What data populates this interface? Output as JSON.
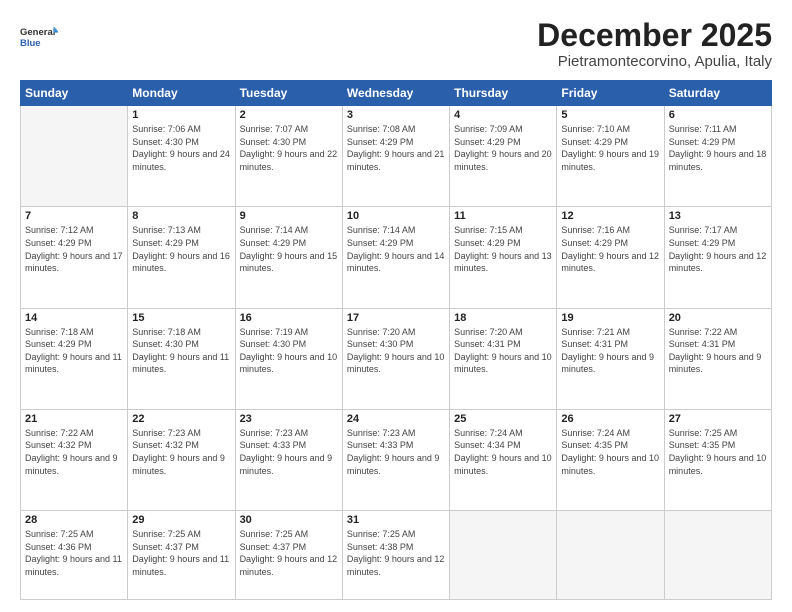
{
  "header": {
    "logo_general": "General",
    "logo_blue": "Blue",
    "month_title": "December 2025",
    "location": "Pietramontecorvino, Apulia, Italy"
  },
  "days_of_week": [
    "Sunday",
    "Monday",
    "Tuesday",
    "Wednesday",
    "Thursday",
    "Friday",
    "Saturday"
  ],
  "weeks": [
    [
      {
        "num": "",
        "empty": true
      },
      {
        "num": "1",
        "sunrise": "7:06 AM",
        "sunset": "4:30 PM",
        "daylight": "9 hours and 24 minutes."
      },
      {
        "num": "2",
        "sunrise": "7:07 AM",
        "sunset": "4:30 PM",
        "daylight": "9 hours and 22 minutes."
      },
      {
        "num": "3",
        "sunrise": "7:08 AM",
        "sunset": "4:29 PM",
        "daylight": "9 hours and 21 minutes."
      },
      {
        "num": "4",
        "sunrise": "7:09 AM",
        "sunset": "4:29 PM",
        "daylight": "9 hours and 20 minutes."
      },
      {
        "num": "5",
        "sunrise": "7:10 AM",
        "sunset": "4:29 PM",
        "daylight": "9 hours and 19 minutes."
      },
      {
        "num": "6",
        "sunrise": "7:11 AM",
        "sunset": "4:29 PM",
        "daylight": "9 hours and 18 minutes."
      }
    ],
    [
      {
        "num": "7",
        "sunrise": "7:12 AM",
        "sunset": "4:29 PM",
        "daylight": "9 hours and 17 minutes."
      },
      {
        "num": "8",
        "sunrise": "7:13 AM",
        "sunset": "4:29 PM",
        "daylight": "9 hours and 16 minutes."
      },
      {
        "num": "9",
        "sunrise": "7:14 AM",
        "sunset": "4:29 PM",
        "daylight": "9 hours and 15 minutes."
      },
      {
        "num": "10",
        "sunrise": "7:14 AM",
        "sunset": "4:29 PM",
        "daylight": "9 hours and 14 minutes."
      },
      {
        "num": "11",
        "sunrise": "7:15 AM",
        "sunset": "4:29 PM",
        "daylight": "9 hours and 13 minutes."
      },
      {
        "num": "12",
        "sunrise": "7:16 AM",
        "sunset": "4:29 PM",
        "daylight": "9 hours and 12 minutes."
      },
      {
        "num": "13",
        "sunrise": "7:17 AM",
        "sunset": "4:29 PM",
        "daylight": "9 hours and 12 minutes."
      }
    ],
    [
      {
        "num": "14",
        "sunrise": "7:18 AM",
        "sunset": "4:29 PM",
        "daylight": "9 hours and 11 minutes."
      },
      {
        "num": "15",
        "sunrise": "7:18 AM",
        "sunset": "4:30 PM",
        "daylight": "9 hours and 11 minutes."
      },
      {
        "num": "16",
        "sunrise": "7:19 AM",
        "sunset": "4:30 PM",
        "daylight": "9 hours and 10 minutes."
      },
      {
        "num": "17",
        "sunrise": "7:20 AM",
        "sunset": "4:30 PM",
        "daylight": "9 hours and 10 minutes."
      },
      {
        "num": "18",
        "sunrise": "7:20 AM",
        "sunset": "4:31 PM",
        "daylight": "9 hours and 10 minutes."
      },
      {
        "num": "19",
        "sunrise": "7:21 AM",
        "sunset": "4:31 PM",
        "daylight": "9 hours and 9 minutes."
      },
      {
        "num": "20",
        "sunrise": "7:22 AM",
        "sunset": "4:31 PM",
        "daylight": "9 hours and 9 minutes."
      }
    ],
    [
      {
        "num": "21",
        "sunrise": "7:22 AM",
        "sunset": "4:32 PM",
        "daylight": "9 hours and 9 minutes."
      },
      {
        "num": "22",
        "sunrise": "7:23 AM",
        "sunset": "4:32 PM",
        "daylight": "9 hours and 9 minutes."
      },
      {
        "num": "23",
        "sunrise": "7:23 AM",
        "sunset": "4:33 PM",
        "daylight": "9 hours and 9 minutes."
      },
      {
        "num": "24",
        "sunrise": "7:23 AM",
        "sunset": "4:33 PM",
        "daylight": "9 hours and 9 minutes."
      },
      {
        "num": "25",
        "sunrise": "7:24 AM",
        "sunset": "4:34 PM",
        "daylight": "9 hours and 10 minutes."
      },
      {
        "num": "26",
        "sunrise": "7:24 AM",
        "sunset": "4:35 PM",
        "daylight": "9 hours and 10 minutes."
      },
      {
        "num": "27",
        "sunrise": "7:25 AM",
        "sunset": "4:35 PM",
        "daylight": "9 hours and 10 minutes."
      }
    ],
    [
      {
        "num": "28",
        "sunrise": "7:25 AM",
        "sunset": "4:36 PM",
        "daylight": "9 hours and 11 minutes."
      },
      {
        "num": "29",
        "sunrise": "7:25 AM",
        "sunset": "4:37 PM",
        "daylight": "9 hours and 11 minutes."
      },
      {
        "num": "30",
        "sunrise": "7:25 AM",
        "sunset": "4:37 PM",
        "daylight": "9 hours and 12 minutes."
      },
      {
        "num": "31",
        "sunrise": "7:25 AM",
        "sunset": "4:38 PM",
        "daylight": "9 hours and 12 minutes."
      },
      {
        "num": "",
        "empty": true
      },
      {
        "num": "",
        "empty": true
      },
      {
        "num": "",
        "empty": true
      }
    ]
  ]
}
